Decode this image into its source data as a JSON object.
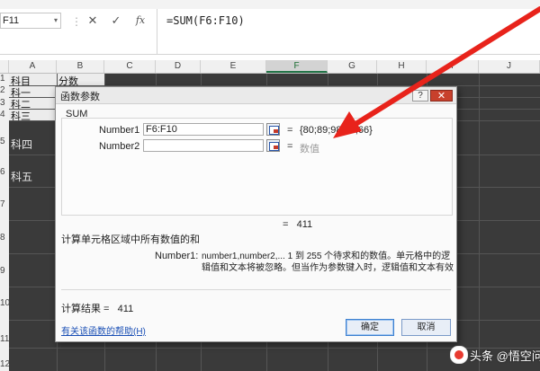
{
  "formula_bar": {
    "name_box": "F11",
    "separator": "⋮",
    "cancel_icon": "✕",
    "enter_icon": "✓",
    "fx_label": "fx",
    "formula": "=SUM(F6:F10)"
  },
  "columns": [
    "A",
    "B",
    "C",
    "D",
    "E",
    "F",
    "G",
    "H",
    "I",
    "J"
  ],
  "rows": [
    "1",
    "2",
    "3",
    "4",
    "5",
    "6",
    "7",
    "8",
    "9",
    "10",
    "11",
    "12"
  ],
  "cells": {
    "a1": "科目",
    "b1": "分数",
    "a2": "科一",
    "a3": "科二",
    "a4": "科三",
    "a5": "科四",
    "a6": "科五"
  },
  "dialog": {
    "title": "函数参数",
    "help_button": "?",
    "close_button": "✕",
    "function_name": "SUM",
    "args": [
      {
        "label": "Number1",
        "value": "F6:F10",
        "equals": "=",
        "result": "{80;89;98;78;66}"
      },
      {
        "label": "Number2",
        "value": "",
        "equals": "=",
        "result": "数值"
      }
    ],
    "total_label": "=",
    "total_value": "411",
    "description": "计算单元格区域中所有数值的和",
    "arg_desc_name": "Number1:",
    "arg_desc_text": "number1,number2,... 1 到 255 个待求和的数值。单元格中的逻辑值和文本将被忽略。但当作为参数键入时，逻辑值和文本有效",
    "result_label": "计算结果 =",
    "result_value": "411",
    "help_link": "有关该函数的帮助(H)",
    "ok_button": "确定",
    "cancel_button": "取消"
  },
  "watermark": "头条 @悟空问答",
  "colors": {
    "arrow": "#e8231b",
    "grid_dark": "#3a3a3a",
    "close_button": "#c8402c",
    "link": "#1a4fb5"
  }
}
